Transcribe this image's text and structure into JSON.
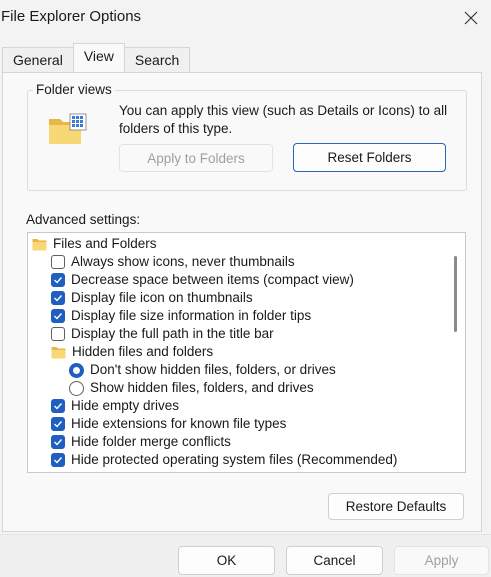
{
  "window": {
    "title": "File Explorer Options",
    "close_icon": "close-icon"
  },
  "tabs": [
    {
      "label": "General",
      "active": false
    },
    {
      "label": "View",
      "active": true
    },
    {
      "label": "Search",
      "active": false
    }
  ],
  "folder_views": {
    "legend": "Folder views",
    "description": "You can apply this view (such as Details or Icons) to all folders of this type.",
    "apply_to_folders_label": "Apply to Folders",
    "reset_folders_label": "Reset Folders"
  },
  "advanced": {
    "label": "Advanced settings:",
    "items": [
      {
        "type": "folder",
        "label": "Files and Folders"
      },
      {
        "type": "checkbox",
        "checked": false,
        "label": "Always show icons, never thumbnails"
      },
      {
        "type": "checkbox",
        "checked": true,
        "label": "Decrease space between items (compact view)"
      },
      {
        "type": "checkbox",
        "checked": true,
        "label": "Display file icon on thumbnails"
      },
      {
        "type": "checkbox",
        "checked": true,
        "label": "Display file size information in folder tips"
      },
      {
        "type": "checkbox",
        "checked": false,
        "label": "Display the full path in the title bar"
      },
      {
        "type": "folder",
        "label": "Hidden files and folders"
      },
      {
        "type": "radio",
        "checked": true,
        "label": "Don't show hidden files, folders, or drives"
      },
      {
        "type": "radio",
        "checked": false,
        "label": "Show hidden files, folders, and drives"
      },
      {
        "type": "checkbox",
        "checked": true,
        "label": "Hide empty drives"
      },
      {
        "type": "checkbox",
        "checked": true,
        "label": "Hide extensions for known file types"
      },
      {
        "type": "checkbox",
        "checked": true,
        "label": "Hide folder merge conflicts"
      },
      {
        "type": "checkbox",
        "checked": true,
        "label": "Hide protected operating system files (Recommended)"
      }
    ],
    "restore_defaults_label": "Restore Defaults"
  },
  "footer": {
    "ok_label": "OK",
    "cancel_label": "Cancel",
    "apply_label": "Apply"
  },
  "colors": {
    "accent": "#1f5fbf",
    "background": "#f3f3f3"
  }
}
